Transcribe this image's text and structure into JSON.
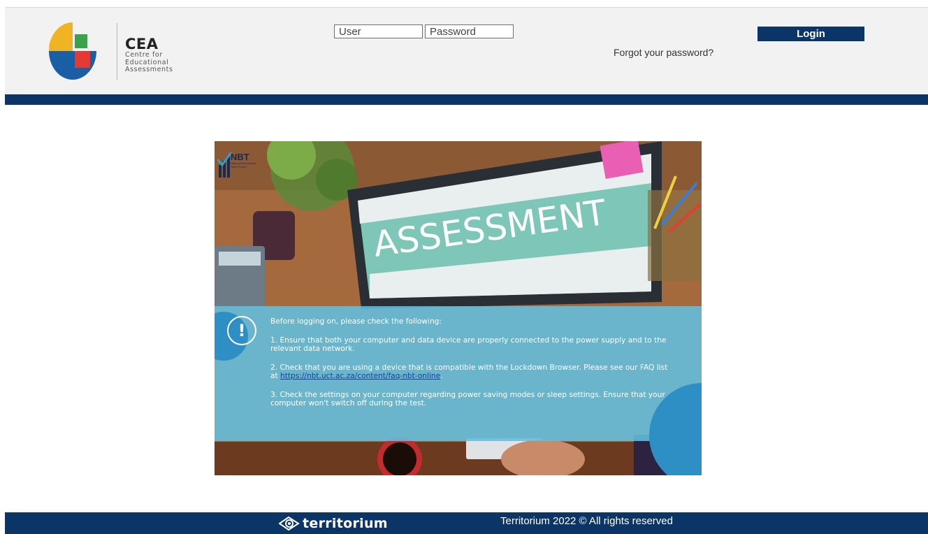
{
  "header": {
    "brand": {
      "abbr": "CEA",
      "line1": "Centre for",
      "line2": "Educational",
      "line3": "Assessments"
    },
    "user_placeholder": "User",
    "password_placeholder": "Password",
    "login_label": "Login",
    "forgot_label": "Forgot your password?"
  },
  "banner": {
    "nbt_abbr": "NBT",
    "nbt_subtitle": "National Benchmark Tests Project",
    "screen_text": "ASSESSMENT",
    "info": {
      "heading": "Before logging on, please check the following:",
      "item1": "1. Ensure that both your computer and data device are properly connected to the power supply and to the relevant data network.",
      "item2_text": "2. Check that you are using a device that is compatible with the Lockdown Browser. Please see our FAQ list at ",
      "item2_link": "https://nbt.uct.ac.za/content/faq-nbt-online",
      "item2_end": ".",
      "item3": "3. Check the settings on your computer regarding power saving modes or sleep settings. Ensure that your computer won't switch off during the test."
    }
  },
  "footer": {
    "logo_text": "territorium",
    "copyright": "Territorium 2022 © All rights reserved"
  },
  "colors": {
    "navy": "#0a3566",
    "header_bg": "#f2f2f2",
    "info_panel": "#62bee0",
    "info_circle": "#2d8fc4",
    "link": "#1a3fa0"
  }
}
